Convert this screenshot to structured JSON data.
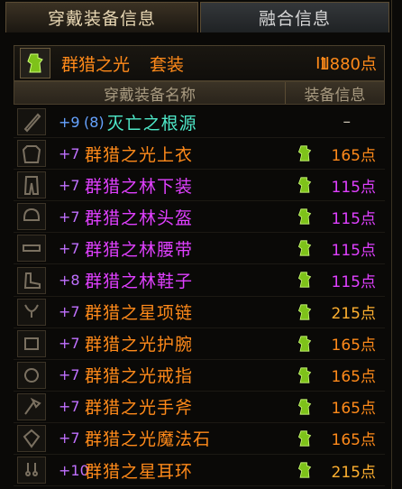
{
  "tabs": [
    {
      "label": "穿戴装备信息"
    },
    {
      "label": "融合信息"
    }
  ],
  "set": {
    "name": "群猎之光",
    "type": "套装",
    "rank": "III",
    "score": "1880点"
  },
  "table": {
    "col_name": "穿戴装备名称",
    "col_info": "装备信息"
  },
  "items": [
    {
      "plus": "+9",
      "sub": "(8)",
      "name": "灭亡之根源",
      "score": "",
      "dash": "–",
      "plus_color": "#66a3ff",
      "name_color": "#4ee8c8",
      "score_color": "#e8c89a",
      "slot_icon": "sword-icon"
    },
    {
      "plus": "+7",
      "name": "群猎之光上衣",
      "score": "165点",
      "plus_color": "#c070ff",
      "name_color": "#ff8a1a",
      "score_color": "#ff8a1a",
      "slot_icon": "coat-icon"
    },
    {
      "plus": "+7",
      "name": "群猎之林下装",
      "score": "115点",
      "plus_color": "#c070ff",
      "name_color": "#e040ff",
      "score_color": "#e040ff",
      "slot_icon": "pants-icon"
    },
    {
      "plus": "+7",
      "name": "群猎之林头盔",
      "score": "115点",
      "plus_color": "#c070ff",
      "name_color": "#e040ff",
      "score_color": "#e040ff",
      "slot_icon": "helmet-icon"
    },
    {
      "plus": "+7",
      "name": "群猎之林腰带",
      "score": "115点",
      "plus_color": "#c070ff",
      "name_color": "#e040ff",
      "score_color": "#e040ff",
      "slot_icon": "belt-icon"
    },
    {
      "plus": "+8",
      "name": "群猎之林鞋子",
      "score": "115点",
      "plus_color": "#c070ff",
      "name_color": "#e040ff",
      "score_color": "#e040ff",
      "slot_icon": "shoe-icon"
    },
    {
      "plus": "+7",
      "name": "群猎之星项链",
      "score": "215点",
      "plus_color": "#c070ff",
      "name_color": "#ff8a1a",
      "score_color": "#ffb030",
      "slot_icon": "necklace-icon"
    },
    {
      "plus": "+7",
      "name": "群猎之光护腕",
      "score": "165点",
      "plus_color": "#c070ff",
      "name_color": "#ff8a1a",
      "score_color": "#ff8a1a",
      "slot_icon": "bracer-icon"
    },
    {
      "plus": "+7",
      "name": "群猎之光戒指",
      "score": "165点",
      "plus_color": "#c070ff",
      "name_color": "#ff8a1a",
      "score_color": "#ff8a1a",
      "slot_icon": "ring-icon"
    },
    {
      "plus": "+7",
      "name": "群猎之光手斧",
      "score": "165点",
      "plus_color": "#c070ff",
      "name_color": "#ff8a1a",
      "score_color": "#ff8a1a",
      "slot_icon": "hatchet-icon"
    },
    {
      "plus": "+7",
      "name": "群猎之光魔法石",
      "score": "165点",
      "plus_color": "#c070ff",
      "name_color": "#ff8a1a",
      "score_color": "#ff8a1a",
      "slot_icon": "magic-stone-icon"
    },
    {
      "plus": "+10",
      "name": "群猎之星耳环",
      "score": "215点",
      "plus_color": "#c070ff",
      "name_color": "#ff8a1a",
      "score_color": "#ffb030",
      "slot_icon": "earring-icon"
    }
  ],
  "colors": {
    "accent": "#ff8a1a",
    "epic": "#e040ff",
    "badge_green": "#7ec21a"
  }
}
